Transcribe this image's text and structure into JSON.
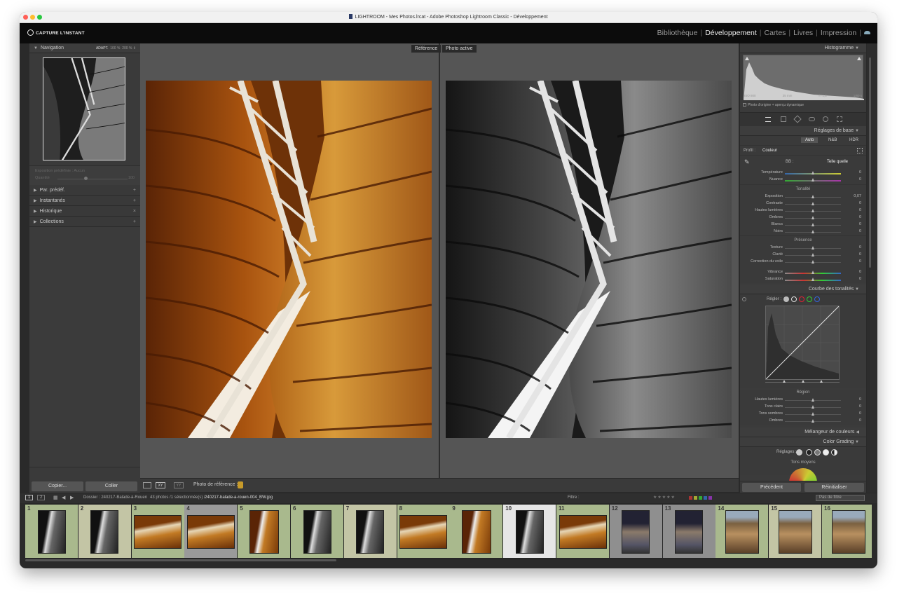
{
  "window": {
    "title": "LIGHTROOM - Mes Photos.lrcat - Adobe Photoshop Lightroom Classic - Développement"
  },
  "identity_plate": {
    "text": "CAPTURE L'INSTANT"
  },
  "modules": [
    "Bibliothèque",
    "Développement",
    "Cartes",
    "Livres",
    "Impression"
  ],
  "active_module": "Développement",
  "left_panel": {
    "navigator": {
      "title": "Navigation",
      "zoom_options": [
        "ADAPT.",
        "100 %",
        "200 %"
      ]
    },
    "preset_sliders": {
      "label": "Exposition prédéfinie : Aucun",
      "amount_label": "Quantité",
      "amount_value": "100"
    },
    "sections": [
      {
        "title": "Par. prédéf.",
        "action": "+"
      },
      {
        "title": "Instantanés",
        "action": "+"
      },
      {
        "title": "Historique",
        "action": "×"
      },
      {
        "title": "Collections",
        "action": "+"
      }
    ],
    "copy_button": "Copier...",
    "paste_button": "Coller"
  },
  "center": {
    "reference_label": "Référence",
    "active_label": "Photo active",
    "reference_photo_label": "Photo de référence :"
  },
  "right_panel": {
    "histogram": {
      "title": "Histogramme",
      "info": [
        "ISO 800",
        "35 mm",
        "f / 1,8",
        "1/80 s"
      ],
      "checkbox_label": "Photo d'origine + aperçu dynamique"
    },
    "basic": {
      "title": "Réglages de base",
      "treatment_buttons": [
        "Auto",
        "N&B",
        "HDR"
      ],
      "profile_label": "Profil :",
      "profile_value": "Couleur",
      "wb_label": "BB :",
      "wb_value": "Telle quelle",
      "wb_sliders": [
        {
          "name": "Température",
          "value": "0",
          "pos": 0.5
        },
        {
          "name": "Nuance",
          "value": "0",
          "pos": 0.5
        }
      ],
      "tone_title": "Tonalité",
      "tone_sliders": [
        {
          "name": "Exposition",
          "value": "0,07",
          "pos": 0.51
        },
        {
          "name": "Contraste",
          "value": "0",
          "pos": 0.5
        },
        {
          "name": "Hautes lumières",
          "value": "0",
          "pos": 0.5
        },
        {
          "name": "Ombres",
          "value": "0",
          "pos": 0.5
        },
        {
          "name": "Blancs",
          "value": "0",
          "pos": 0.5
        },
        {
          "name": "Noirs",
          "value": "0",
          "pos": 0.5
        }
      ],
      "presence_title": "Présence",
      "presence_sliders": [
        {
          "name": "Texture",
          "value": "0",
          "pos": 0.5
        },
        {
          "name": "Clarté",
          "value": "0",
          "pos": 0.5
        },
        {
          "name": "Correction du voile",
          "value": "0",
          "pos": 0.5
        }
      ],
      "presence_sliders2": [
        {
          "name": "Vibrance",
          "value": "0",
          "pos": 0.5
        },
        {
          "name": "Saturation",
          "value": "0",
          "pos": 0.5
        }
      ]
    },
    "tone_curve": {
      "title": "Courbe des tonalités",
      "adjust_label": "Régler :",
      "region_title": "Région",
      "region_sliders": [
        {
          "name": "Hautes lumières",
          "value": "0",
          "pos": 0.5
        },
        {
          "name": "Tons clairs",
          "value": "0",
          "pos": 0.5
        },
        {
          "name": "Tons sombres",
          "value": "0",
          "pos": 0.5
        },
        {
          "name": "Ombres",
          "value": "0",
          "pos": 0.5
        }
      ]
    },
    "color_mixer": {
      "title": "Mélangeur de couleurs"
    },
    "color_grading": {
      "title": "Color Grading",
      "adjust_label": "Réglages :",
      "sub_label": "Tons moyens"
    },
    "prev_button": "Précédent",
    "reset_button": "Réinitialiser"
  },
  "filmstrip_bar": {
    "source": "Dossier : 240217-Balade-à-Rouen",
    "count": "43 photos /1 sélectionnée(s) /",
    "filename": "240217-balade-a-rouen-004_BW.jpg",
    "filter_label": "Filtre :",
    "filter_value": "Pas de filtre",
    "screen_buttons": [
      "1",
      "2"
    ]
  },
  "filmstrip": [
    {
      "n": "1",
      "bg": "#a9b98d",
      "kind": "bw-tall"
    },
    {
      "n": "2",
      "bg": "#c3c5a5",
      "kind": "bw-tall"
    },
    {
      "n": "3",
      "bg": "#a9b98d",
      "kind": "wood-wide"
    },
    {
      "n": "4",
      "bg": "#9a9a9a",
      "kind": "wood-wide"
    },
    {
      "n": "5",
      "bg": "#a9b98d",
      "kind": "wood-tall"
    },
    {
      "n": "6",
      "bg": "#a9b98d",
      "kind": "bw-tall"
    },
    {
      "n": "7",
      "bg": "#c3c5a5",
      "kind": "bw-tall"
    },
    {
      "n": "8",
      "bg": "#a9b98d",
      "kind": "wood-wide"
    },
    {
      "n": "9",
      "bg": "#a9b98d",
      "kind": "wood-tall"
    },
    {
      "n": "10",
      "bg": "#e6e6e6",
      "kind": "bw-tall"
    },
    {
      "n": "11",
      "bg": "#a9b98d",
      "kind": "wood-wide"
    },
    {
      "n": "12",
      "bg": "#8f8f8f",
      "kind": "street"
    },
    {
      "n": "13",
      "bg": "#8f8f8f",
      "kind": "street"
    },
    {
      "n": "14",
      "bg": "#a9b98d",
      "kind": "building"
    },
    {
      "n": "15",
      "bg": "#c3c5a5",
      "kind": "building"
    },
    {
      "n": "16",
      "bg": "#a9b98d",
      "kind": "building"
    }
  ]
}
